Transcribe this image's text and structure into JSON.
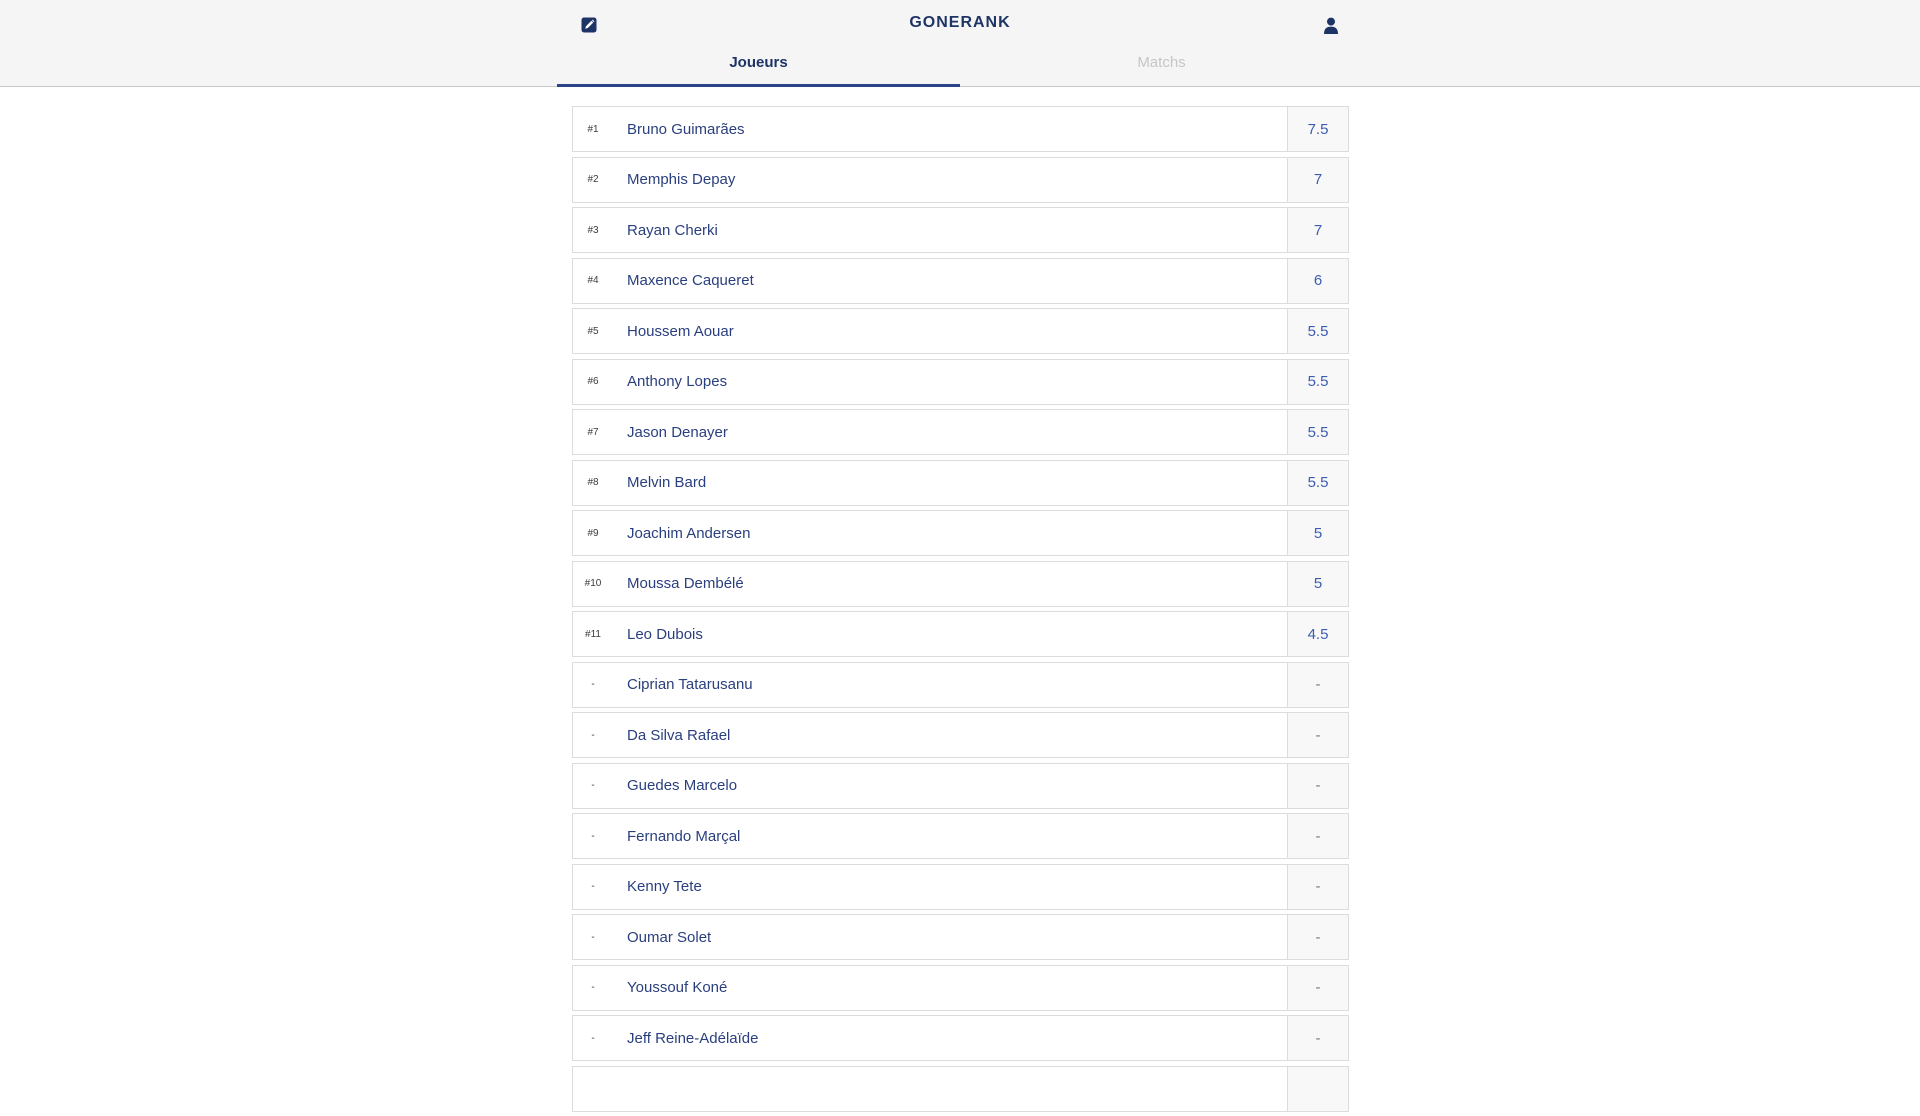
{
  "header": {
    "title": "GONERANK",
    "edit_icon": "edit-icon",
    "user_icon": "user-icon",
    "accent_color": "#1e3466"
  },
  "tabs": [
    {
      "label": "Joueurs",
      "active": true
    },
    {
      "label": "Matchs",
      "active": false
    }
  ],
  "players": [
    {
      "rank": "#1",
      "name": "Bruno Guimarães",
      "score": "7.5"
    },
    {
      "rank": "#2",
      "name": "Memphis Depay",
      "score": "7"
    },
    {
      "rank": "#3",
      "name": "Rayan Cherki",
      "score": "7"
    },
    {
      "rank": "#4",
      "name": "Maxence Caqueret",
      "score": "6"
    },
    {
      "rank": "#5",
      "name": "Houssem Aouar",
      "score": "5.5"
    },
    {
      "rank": "#6",
      "name": "Anthony Lopes",
      "score": "5.5"
    },
    {
      "rank": "#7",
      "name": "Jason Denayer",
      "score": "5.5"
    },
    {
      "rank": "#8",
      "name": "Melvin Bard",
      "score": "5.5"
    },
    {
      "rank": "#9",
      "name": "Joachim Andersen",
      "score": "5"
    },
    {
      "rank": "#10",
      "name": "Moussa Dembélé",
      "score": "5"
    },
    {
      "rank": "#11",
      "name": "Leo Dubois",
      "score": "4.5"
    },
    {
      "rank": "-",
      "name": "Ciprian Tatarusanu",
      "score": "-"
    },
    {
      "rank": "-",
      "name": "Da Silva Rafael",
      "score": "-"
    },
    {
      "rank": "-",
      "name": "Guedes Marcelo",
      "score": "-"
    },
    {
      "rank": "-",
      "name": "Fernando Marçal",
      "score": "-"
    },
    {
      "rank": "-",
      "name": "Kenny Tete",
      "score": "-"
    },
    {
      "rank": "-",
      "name": "Oumar Solet",
      "score": "-"
    },
    {
      "rank": "-",
      "name": "Youssouf Koné",
      "score": "-"
    },
    {
      "rank": "-",
      "name": "Jeff Reine-Adélaïde",
      "score": "-"
    },
    {
      "rank": "",
      "name": "",
      "score": ""
    }
  ]
}
